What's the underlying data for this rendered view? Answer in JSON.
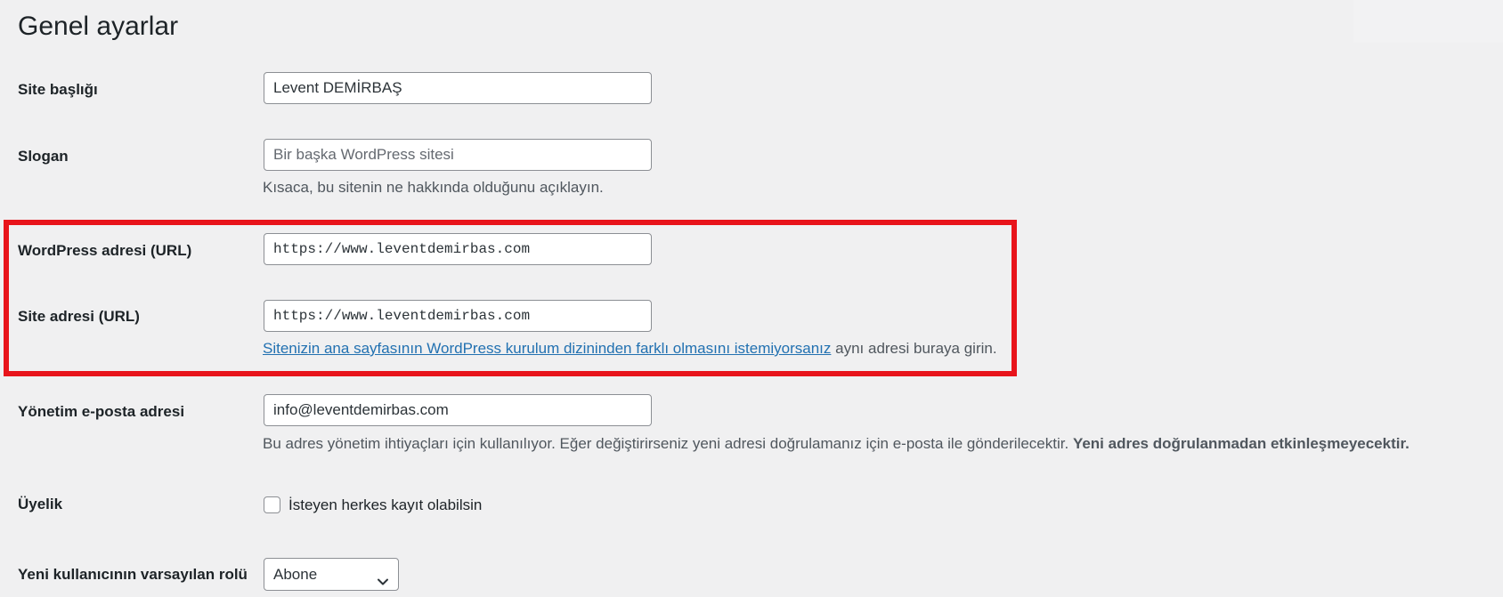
{
  "page": {
    "title": "Genel ayarlar"
  },
  "fields": {
    "site_title": {
      "label": "Site başlığı",
      "value": "Levent DEMİRBAŞ"
    },
    "tagline": {
      "label": "Slogan",
      "placeholder": "Bir başka WordPress sitesi",
      "description": "Kısaca, bu sitenin ne hakkında olduğunu açıklayın."
    },
    "wp_address": {
      "label": "WordPress adresi (URL)",
      "value": "https://www.leventdemirbas.com"
    },
    "site_address": {
      "label": "Site adresi (URL)",
      "value": "https://www.leventdemirbas.com",
      "description_link": "Sitenizin ana sayfasının WordPress kurulum dizininden farklı olmasını istemiyorsanız",
      "description_rest": " aynı adresi buraya girin."
    },
    "admin_email": {
      "label": "Yönetim e-posta adresi",
      "value": "info@leventdemirbas.com",
      "description": "Bu adres yönetim ihtiyaçları için kullanılıyor. Eğer değiştirirseniz yeni adresi doğrulamanız için e-posta ile gönderilecektir. ",
      "description_bold": "Yeni adres doğrulanmadan etkinleşmeyecektir."
    },
    "membership": {
      "label": "Üyelik",
      "checkbox_label": "İsteyen herkes kayıt olabilsin",
      "checked": false
    },
    "default_role": {
      "label": "Yeni kullanıcının varsayılan rolü",
      "selected": "Abone"
    }
  },
  "highlight_color": "#e8141b"
}
